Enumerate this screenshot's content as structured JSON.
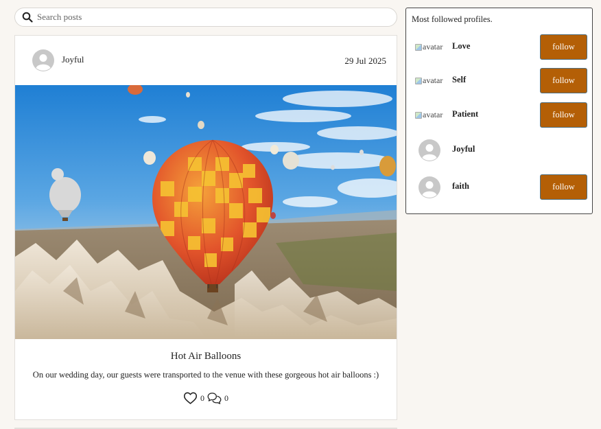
{
  "search": {
    "placeholder": "Search posts",
    "icon": "search-icon"
  },
  "post": {
    "author": "Joyful",
    "date": "29 Jul 2025",
    "image_alt": "Hot air balloons over Cappadocia",
    "title": "Hot Air Balloons",
    "body": "On our wedding day, our guests were transported to the venue with these gorgeous hot air balloons :)",
    "likes": "0",
    "comments": "0"
  },
  "sidebar": {
    "title": "Most followed profiles.",
    "profiles": [
      {
        "name": "Love",
        "avatar_alt": "avatar",
        "avatar_broken": true,
        "follow_label": "follow"
      },
      {
        "name": "Self",
        "avatar_alt": "avatar",
        "avatar_broken": true,
        "follow_label": "follow"
      },
      {
        "name": "Patient",
        "avatar_alt": "avatar",
        "avatar_broken": true,
        "follow_label": "follow"
      },
      {
        "name": "Joyful",
        "avatar_alt": "",
        "avatar_broken": false,
        "follow_label": ""
      },
      {
        "name": "faith",
        "avatar_alt": "",
        "avatar_broken": false,
        "follow_label": "follow"
      }
    ]
  },
  "colors": {
    "accent": "#b45f06",
    "background": "#f9f6f2",
    "button_border": "#4d6e80"
  }
}
